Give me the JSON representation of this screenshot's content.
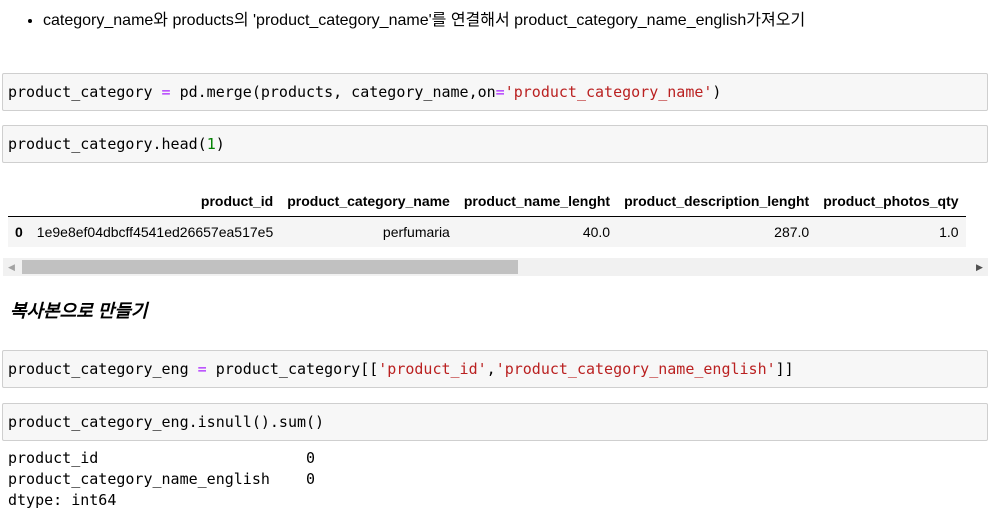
{
  "markdown_bullet": "category_name와 products의 'product_category_name'를 연결해서 product_category_name_english가져오기",
  "cells": {
    "merge": {
      "var": "product_category",
      "eq": "=",
      "call": "pd.merge(products, category_name,on",
      "eq2": "=",
      "arg_str": "'product_category_name'",
      "close": ")"
    },
    "head": {
      "pre": "product_category.head(",
      "num": "1",
      "close": ")"
    },
    "eng": {
      "var": "product_category_eng",
      "eq": "=",
      "pre": "product_category[[",
      "str1": "'product_id'",
      "comma": ",",
      "str2": "'product_category_name_english'",
      "close": "]]"
    },
    "isnull": {
      "code": "product_category_eng.isnull().sum()"
    }
  },
  "dataframe": {
    "columns": [
      "",
      "product_id",
      "product_category_name",
      "product_name_lenght",
      "product_description_lenght",
      "product_photos_qty"
    ],
    "rows": [
      [
        "0",
        "1e9e8ef04dbcff4541ed26657ea517e5",
        "perfumaria",
        "40.0",
        "287.0",
        "1.0"
      ]
    ]
  },
  "scrollbar": {
    "left_arrow": "◀",
    "right_arrow": "▶",
    "position": 0.52
  },
  "heading": "복사본으로 만들기",
  "output": {
    "lines": [
      "product_id                       0",
      "product_category_name_english    0",
      "dtype: int64"
    ]
  }
}
